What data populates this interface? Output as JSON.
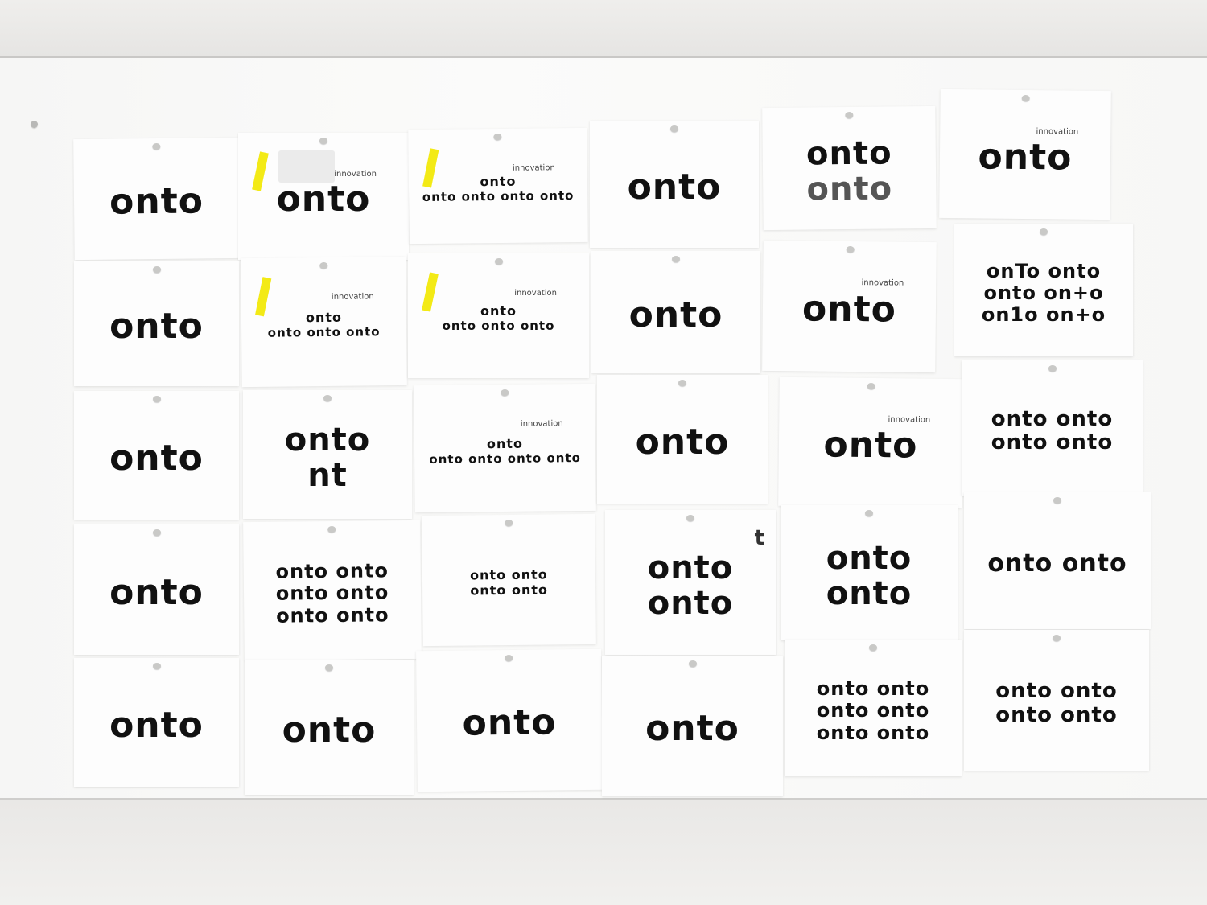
{
  "scene": {
    "description_tags": [
      "whiteboard",
      "logo sketches",
      "paper cards"
    ],
    "colors": {
      "board": "#fbfbfa",
      "paper": "#fdfdfd",
      "ink": "#111111",
      "tape": "#f3ea16"
    },
    "cards": [
      {
        "id": "r1c1",
        "lines": [
          "onto"
        ],
        "taped": false,
        "greyLast": false
      },
      {
        "id": "r1c2",
        "lines": [
          "onto"
        ],
        "tag": "innovation",
        "taped": true,
        "sketch": true
      },
      {
        "id": "r1c3",
        "lines": [
          "onto",
          "onto onto onto onto"
        ],
        "tag": "innovation",
        "taped": true
      },
      {
        "id": "r1c4",
        "lines": [
          "onto"
        ]
      },
      {
        "id": "r1c5",
        "lines": [
          "onto",
          "onto"
        ],
        "greyLast": true
      },
      {
        "id": "r1c6",
        "lines": [
          "onto"
        ],
        "tag": "innovation"
      },
      {
        "id": "r2c1",
        "lines": [
          "onto"
        ]
      },
      {
        "id": "r2c2",
        "lines": [
          "onto",
          "onto   onto   onto"
        ],
        "tag": "innovation",
        "taped": true
      },
      {
        "id": "r2c3",
        "lines": [
          "onto",
          "onto  onto  onto"
        ],
        "tag": "innovation",
        "taped": true
      },
      {
        "id": "r2c4",
        "lines": [
          "onto"
        ]
      },
      {
        "id": "r2c5",
        "lines": [
          "onto"
        ],
        "tag": "innovation"
      },
      {
        "id": "r2c6",
        "lines": [
          "onTo onto",
          "onto on+o",
          "on1o on+o"
        ]
      },
      {
        "id": "r3c1",
        "lines": [
          "onto"
        ]
      },
      {
        "id": "r3c2",
        "lines": [
          "onto",
          "nt"
        ]
      },
      {
        "id": "r3c3",
        "lines": [
          "onto",
          "onto onto onto onto"
        ],
        "tag": "innovation"
      },
      {
        "id": "r3c4",
        "lines": [
          "onto"
        ]
      },
      {
        "id": "r3c5",
        "lines": [
          "onto"
        ],
        "tag": "innovation"
      },
      {
        "id": "r3c6",
        "lines": [
          "onto onto",
          "onto onto"
        ]
      },
      {
        "id": "r4c1",
        "lines": [
          "onto"
        ]
      },
      {
        "id": "r4c2",
        "lines": [
          "onto onto",
          "onto onto",
          "onto onto"
        ]
      },
      {
        "id": "r4c3",
        "lines": [
          "onto     onto",
          "onto     onto"
        ]
      },
      {
        "id": "r4c4",
        "lines": [
          "onto",
          "onto"
        ],
        "side": "t"
      },
      {
        "id": "r4c5",
        "lines": [
          "onto",
          "onto"
        ]
      },
      {
        "id": "r4c6",
        "lines": [
          "onto onto"
        ]
      },
      {
        "id": "r5c1",
        "lines": [
          "onto"
        ]
      },
      {
        "id": "r5c2",
        "lines": [
          "onto"
        ]
      },
      {
        "id": "r5c3",
        "lines": [
          "onto"
        ]
      },
      {
        "id": "r5c4",
        "lines": [
          "onto"
        ]
      },
      {
        "id": "r5c5",
        "lines": [
          "onto onto",
          "onto onto",
          "onto onto"
        ]
      },
      {
        "id": "r5c6",
        "lines": [
          "onto onto",
          "onto onto"
        ]
      }
    ]
  }
}
